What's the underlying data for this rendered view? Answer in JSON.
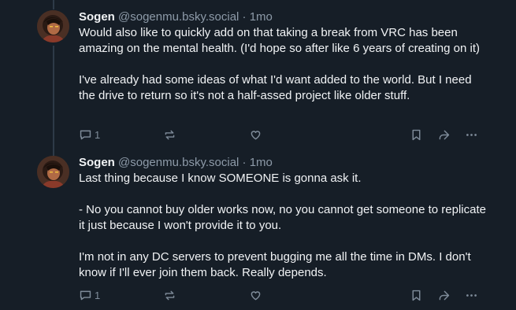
{
  "posts": [
    {
      "name": "Sogen",
      "handle": "@sogenmu.bsky.social",
      "separator": "·",
      "time": "1mo",
      "paragraphs": [
        "Would also like to quickly add on that taking a break from VRC has been amazing on the mental health. (I'd hope so after like 6 years of creating on it)",
        "I've already had some ideas of what I'd want added to the world. But I need the drive to return so it's not a half-assed project like older stuff."
      ],
      "reply_count": "1"
    },
    {
      "name": "Sogen",
      "handle": "@sogenmu.bsky.social",
      "separator": "·",
      "time": "1mo",
      "paragraphs": [
        "Last thing because I know SOMEONE is gonna ask it.",
        "- No you cannot buy older works now, no you cannot get someone to replicate it just because I won't provide it to you.",
        "I'm not in any DC servers to prevent bugging me all the time in DMs. I don't know if I'll ever join them back. Really depends."
      ],
      "reply_count": "1"
    }
  ],
  "icons": {
    "reply": "speech-bubble-icon",
    "repost": "repost-arrows-icon",
    "like": "heart-icon",
    "bookmark": "bookmark-icon",
    "share": "share-arrow-icon",
    "more": "ellipsis-icon"
  },
  "colors": {
    "background": "#161e27",
    "text": "#f1f3f5",
    "muted": "#8d9aa8",
    "icon": "#7f8c9a",
    "thread_line": "#2e3a48"
  }
}
